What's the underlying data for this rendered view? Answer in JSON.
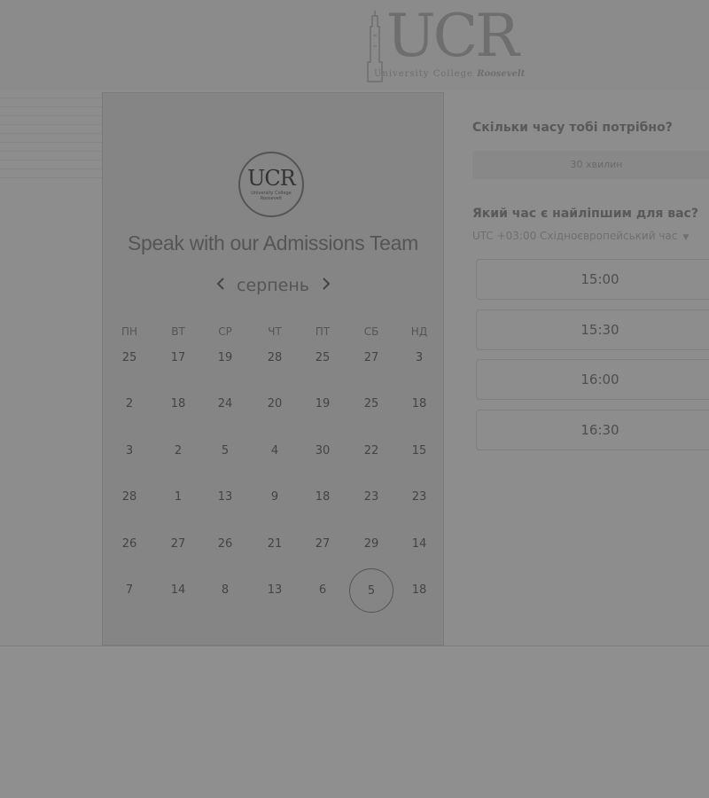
{
  "header": {
    "logo_text": "UCR",
    "logo_subtitle": "University College",
    "logo_subtitle_script": "Roosevelt"
  },
  "card": {
    "badge_text": "UCR",
    "badge_subtitle": "University College Roosevelt",
    "title": "Speak with our Admissions Team",
    "month": "серпень",
    "prev_icon": "chevron-left-icon",
    "next_icon": "chevron-right-icon",
    "weekdays": [
      "ПН",
      "ВТ",
      "СР",
      "ЧТ",
      "ПТ",
      "СБ",
      "НД"
    ],
    "weeks": [
      [
        "25",
        "17",
        "19",
        "28",
        "25",
        "27",
        "3"
      ],
      [
        "2",
        "18",
        "24",
        "20",
        "19",
        "25",
        "18"
      ],
      [
        "3",
        "2",
        "5",
        "4",
        "30",
        "22",
        "15"
      ],
      [
        "28",
        "1",
        "13",
        "9",
        "18",
        "23",
        "23"
      ],
      [
        "26",
        "27",
        "26",
        "21",
        "27",
        "29",
        "14"
      ],
      [
        "7",
        "14",
        "8",
        "13",
        "6",
        "5",
        "18"
      ]
    ],
    "selected_day": "5"
  },
  "scheduler": {
    "duration_question": "Скільки часу тобі потрібно?",
    "duration_value": "30 хвилин",
    "time_question": "Який час є найліпшим для вас?",
    "timezone": "UTC +03:00 Східноєвропейський час",
    "slots": [
      "15:00",
      "15:30",
      "16:00",
      "16:30"
    ]
  }
}
